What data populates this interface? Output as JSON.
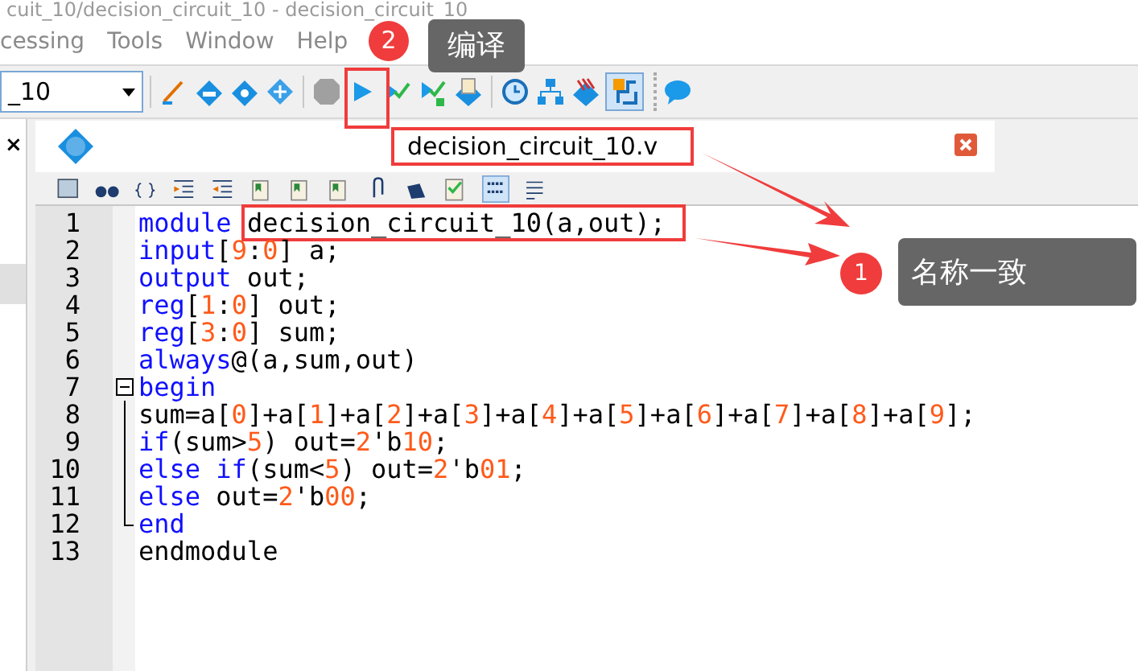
{
  "window": {
    "title": "cuit_10/decision_circuit_10 - decision_circuit_10"
  },
  "menu": [
    {
      "label": "cessing"
    },
    {
      "label": "Tools"
    },
    {
      "label": "Window"
    },
    {
      "label": "Help"
    }
  ],
  "toolbar": {
    "project_combo": "_10"
  },
  "left_panel": {
    "close": "×"
  },
  "editor": {
    "tab": "decision_circuit_10.v",
    "tab_highlighted": true,
    "lines": [
      {
        "number": "1",
        "kind": "plain",
        "tokens": [
          {
            "kind": "keyword",
            "text": "module "
          },
          {
            "kind": "plain",
            "text": "decision_circuit_10(a,out);",
            "highlighted": true
          }
        ]
      },
      {
        "number": "2",
        "kind": "plain",
        "tokens": [
          {
            "kind": "keyword",
            "text": "input"
          },
          {
            "kind": "plain",
            "text": "["
          },
          {
            "kind": "number",
            "text": "9"
          },
          {
            "kind": "plain",
            "text": ":"
          },
          {
            "kind": "number",
            "text": "0"
          },
          {
            "kind": "plain",
            "text": "] a;"
          }
        ]
      },
      {
        "number": "3",
        "kind": "plain",
        "tokens": [
          {
            "kind": "keyword",
            "text": "output"
          },
          {
            "kind": "plain",
            "text": " out;"
          }
        ]
      },
      {
        "number": "4",
        "kind": "plain",
        "tokens": [
          {
            "kind": "keyword",
            "text": "reg"
          },
          {
            "kind": "plain",
            "text": "["
          },
          {
            "kind": "number",
            "text": "1"
          },
          {
            "kind": "plain",
            "text": ":"
          },
          {
            "kind": "number",
            "text": "0"
          },
          {
            "kind": "plain",
            "text": "] out;"
          }
        ]
      },
      {
        "number": "5",
        "kind": "plain",
        "tokens": [
          {
            "kind": "keyword",
            "text": "reg"
          },
          {
            "kind": "plain",
            "text": "["
          },
          {
            "kind": "number",
            "text": "3"
          },
          {
            "kind": "plain",
            "text": ":"
          },
          {
            "kind": "number",
            "text": "0"
          },
          {
            "kind": "plain",
            "text": "] sum;"
          }
        ]
      },
      {
        "number": "6",
        "kind": "plain",
        "tokens": [
          {
            "kind": "keyword",
            "text": "always"
          },
          {
            "kind": "plain",
            "text": "@(a,sum,out)"
          }
        ]
      },
      {
        "number": "7",
        "kind": "fold_start",
        "tokens": [
          {
            "kind": "keyword",
            "text": "begin"
          }
        ]
      },
      {
        "number": "8",
        "kind": "fold_body",
        "tokens": [
          {
            "kind": "plain",
            "text": "sum=a["
          },
          {
            "kind": "number",
            "text": "0"
          },
          {
            "kind": "plain",
            "text": "]+a["
          },
          {
            "kind": "number",
            "text": "1"
          },
          {
            "kind": "plain",
            "text": "]+a["
          },
          {
            "kind": "number",
            "text": "2"
          },
          {
            "kind": "plain",
            "text": "]+a["
          },
          {
            "kind": "number",
            "text": "3"
          },
          {
            "kind": "plain",
            "text": "]+a["
          },
          {
            "kind": "number",
            "text": "4"
          },
          {
            "kind": "plain",
            "text": "]+a["
          },
          {
            "kind": "number",
            "text": "5"
          },
          {
            "kind": "plain",
            "text": "]+a["
          },
          {
            "kind": "number",
            "text": "6"
          },
          {
            "kind": "plain",
            "text": "]+a["
          },
          {
            "kind": "number",
            "text": "7"
          },
          {
            "kind": "plain",
            "text": "]+a["
          },
          {
            "kind": "number",
            "text": "8"
          },
          {
            "kind": "plain",
            "text": "]+a["
          },
          {
            "kind": "number",
            "text": "9"
          },
          {
            "kind": "plain",
            "text": "];"
          }
        ]
      },
      {
        "number": "9",
        "kind": "fold_body",
        "tokens": [
          {
            "kind": "keyword",
            "text": "if"
          },
          {
            "kind": "plain",
            "text": "(sum>"
          },
          {
            "kind": "number",
            "text": "5"
          },
          {
            "kind": "plain",
            "text": ") out="
          },
          {
            "kind": "number",
            "text": "2"
          },
          {
            "kind": "plain",
            "text": "'b"
          },
          {
            "kind": "number",
            "text": "10"
          },
          {
            "kind": "plain",
            "text": ";"
          }
        ]
      },
      {
        "number": "10",
        "kind": "fold_body",
        "tokens": [
          {
            "kind": "keyword",
            "text": "else if"
          },
          {
            "kind": "plain",
            "text": "(sum<"
          },
          {
            "kind": "number",
            "text": "5"
          },
          {
            "kind": "plain",
            "text": ") out="
          },
          {
            "kind": "number",
            "text": "2"
          },
          {
            "kind": "plain",
            "text": "'b"
          },
          {
            "kind": "number",
            "text": "01"
          },
          {
            "kind": "plain",
            "text": ";"
          }
        ]
      },
      {
        "number": "11",
        "kind": "fold_body",
        "tokens": [
          {
            "kind": "keyword",
            "text": "else"
          },
          {
            "kind": "plain",
            "text": " out="
          },
          {
            "kind": "number",
            "text": "2"
          },
          {
            "kind": "plain",
            "text": "'b"
          },
          {
            "kind": "number",
            "text": "00"
          },
          {
            "kind": "plain",
            "text": ";"
          }
        ]
      },
      {
        "number": "12",
        "kind": "fold_end",
        "tokens": [
          {
            "kind": "keyword",
            "text": "end"
          }
        ]
      },
      {
        "number": "13",
        "kind": "plain",
        "tokens": [
          {
            "kind": "plain",
            "text": "endmodule"
          }
        ]
      }
    ]
  },
  "annotations": [
    {
      "badge": "2",
      "label": "编译"
    },
    {
      "badge": "1",
      "label": "名称一致"
    }
  ]
}
